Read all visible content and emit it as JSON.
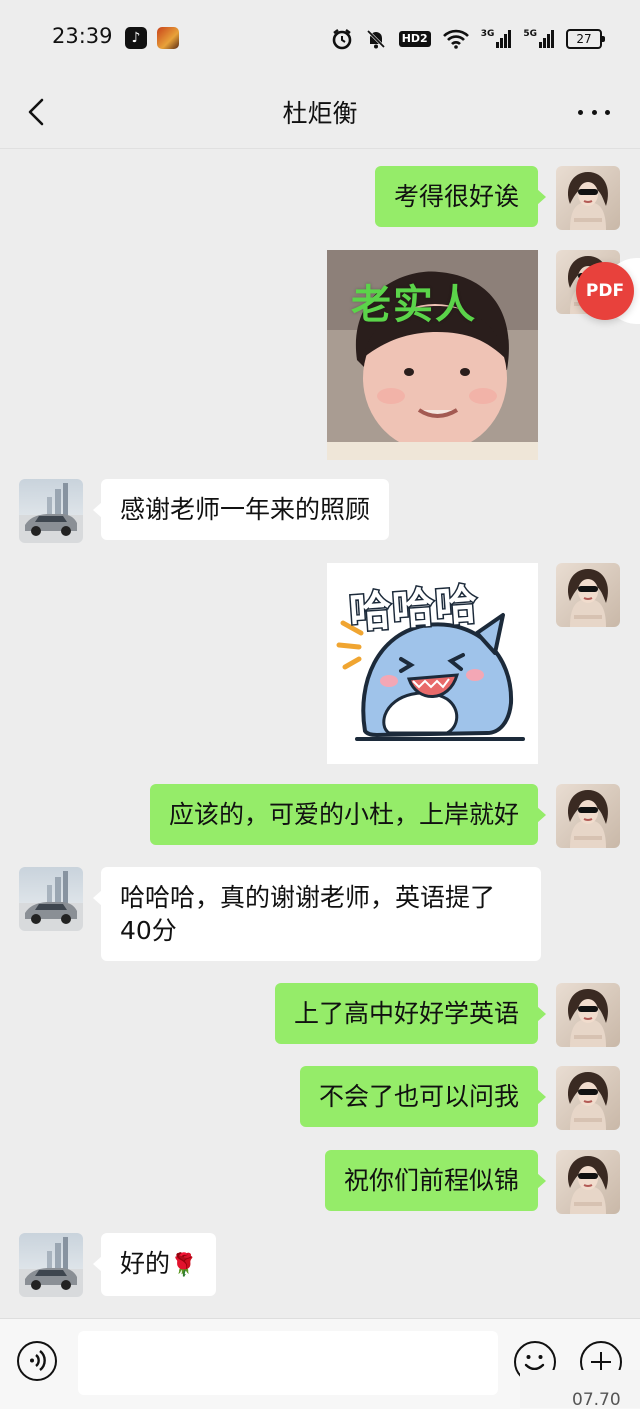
{
  "status_bar": {
    "time": "23:39",
    "network_label": "HD2",
    "signal_1_label": "3G",
    "signal_2_label": "5G",
    "battery": "27",
    "tiktok_glyph": "♪",
    "icons": [
      "tiktok-icon",
      "game-icon",
      "alarm-icon",
      "mute-icon",
      "hd-icon",
      "wifi-icon",
      "signal-icon",
      "battery-icon"
    ]
  },
  "header": {
    "title": "杜炬衡",
    "back_icon": "chevron-left-icon",
    "more_icon": "more-dots-icon"
  },
  "messages": [
    {
      "from": "me",
      "type": "text",
      "text": "考得很好诶"
    },
    {
      "from": "me",
      "type": "sticker",
      "caption": "老实人"
    },
    {
      "from": "them",
      "type": "text",
      "text": "感谢老师一年来的照顾"
    },
    {
      "from": "me",
      "type": "sticker",
      "caption": "哈哈哈"
    },
    {
      "from": "me",
      "type": "text",
      "text": "应该的，可爱的小杜，上岸就好"
    },
    {
      "from": "them",
      "type": "text",
      "text": "哈哈哈，真的谢谢老师，英语提了40分"
    },
    {
      "from": "me",
      "type": "text",
      "text": "上了高中好好学英语"
    },
    {
      "from": "me",
      "type": "text",
      "text": "不会了也可以问我"
    },
    {
      "from": "me",
      "type": "text",
      "text": "祝你们前程似锦"
    },
    {
      "from": "them",
      "type": "text",
      "text": "好的",
      "emoji": "🌹"
    }
  ],
  "floating": {
    "pdf_label": "PDF"
  },
  "input_bar": {
    "placeholder": "",
    "timestamp_partial": "07.70"
  },
  "colors": {
    "background": "#ededed",
    "my_bubble": "#95ec69",
    "their_bubble": "#ffffff",
    "pdf_button": "#e8413c"
  }
}
